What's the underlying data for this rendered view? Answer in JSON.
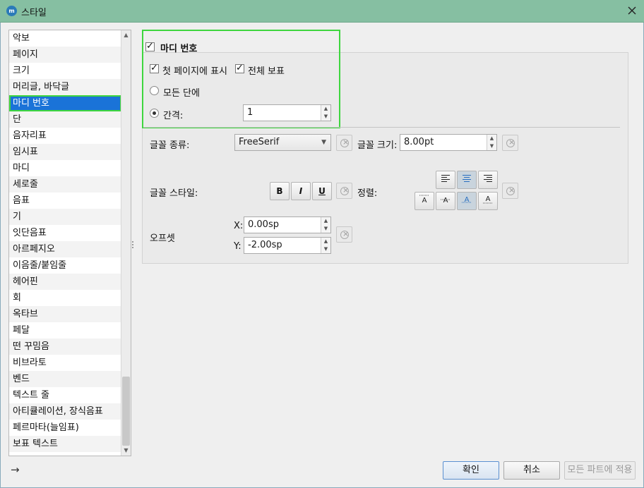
{
  "window": {
    "title": "스타일",
    "app_icon": "musescore-icon"
  },
  "sidebar": {
    "items": [
      {
        "label": "악보"
      },
      {
        "label": "페이지"
      },
      {
        "label": "크기"
      },
      {
        "label": "머리글, 바닥글"
      },
      {
        "label": "마디 번호"
      },
      {
        "label": "단"
      },
      {
        "label": "음자리표"
      },
      {
        "label": "임시표"
      },
      {
        "label": "마디"
      },
      {
        "label": "세로줄"
      },
      {
        "label": "음표"
      },
      {
        "label": "기"
      },
      {
        "label": "잇단음표"
      },
      {
        "label": "아르페지오"
      },
      {
        "label": "이음줄/붙임줄"
      },
      {
        "label": "헤어핀"
      },
      {
        "label": "회"
      },
      {
        "label": "옥타브"
      },
      {
        "label": "페달"
      },
      {
        "label": "떤 꾸밈음"
      },
      {
        "label": "비브라토"
      },
      {
        "label": "벤드"
      },
      {
        "label": "텍스트 줄"
      },
      {
        "label": "아티큘레이션, 장식음표"
      },
      {
        "label": "페르마타(늘임표)"
      },
      {
        "label": "보표 텍스트"
      }
    ],
    "selected_index": 4
  },
  "measure_numbers": {
    "enable_label": "마디 번호",
    "enable_checked": true,
    "first_page_label": "첫 페이지에 표시",
    "first_page_checked": true,
    "all_staves_label": "전체 보표",
    "all_staves_checked": true,
    "every_system_label": "모든 단에",
    "interval_label": "간격:",
    "interval_value": "1",
    "selected_mode": "interval"
  },
  "text_style": {
    "font_face_label": "글꼴 종류:",
    "font_face_value": "FreeSerif",
    "font_size_label": "글꼴 크기:",
    "font_size_value": "8.00pt",
    "font_style_label": "글꼴 스타일:",
    "bold_label": "B",
    "italic_label": "I",
    "underline_label": "U",
    "align_label": "정렬:",
    "horizontal_align": "center",
    "vertical_align": "baseline",
    "offset_label": "오프셋",
    "x_label": "X:",
    "x_value": "0.00sp",
    "y_label": "Y:",
    "y_value": "-2.00sp"
  },
  "footer": {
    "ok_label": "확인",
    "cancel_label": "취소",
    "apply_all_label": "모든 파트에 적용"
  }
}
